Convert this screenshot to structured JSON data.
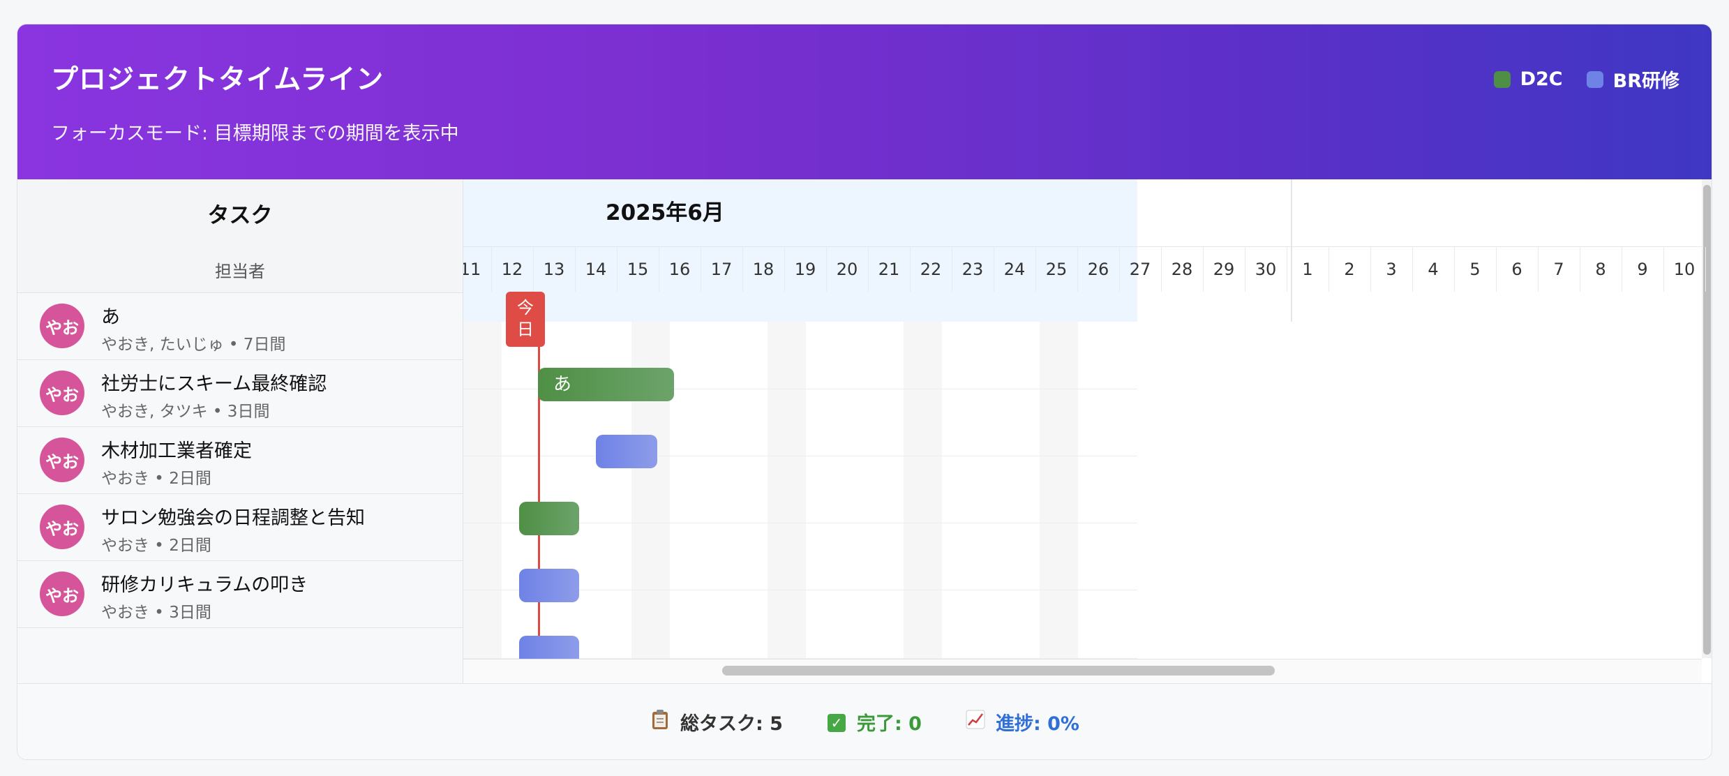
{
  "header": {
    "title": "プロジェクトタイムライン",
    "subtitle": "フォーカスモード: 目標期限までの期間を表示中",
    "legend": [
      {
        "label": "D2C",
        "color": "#4f8f45"
      },
      {
        "label": "BR研修",
        "color": "#6f82e6"
      }
    ]
  },
  "columns": {
    "task_header": "タスク",
    "assignee_header": "担当者"
  },
  "tasks": [
    {
      "avatar": "やお",
      "name": "あ",
      "meta": "やおき, たいじゅ • 7日間"
    },
    {
      "avatar": "やお",
      "name": "社労士にスキーム最終確認",
      "meta": "やおき, タツキ • 3日間"
    },
    {
      "avatar": "やお",
      "name": "木材加工業者確定",
      "meta": "やおき • 2日間"
    },
    {
      "avatar": "やお",
      "name": "サロン勉強会の日程調整と告知",
      "meta": "やおき • 2日間"
    },
    {
      "avatar": "やお",
      "name": "研修カリキュラムの叩き",
      "meta": "やおき • 3日間"
    }
  ],
  "timeline": {
    "month_label": "2025年6月",
    "days": [
      "11",
      "12",
      "13",
      "14",
      "15",
      "16",
      "17",
      "18",
      "19",
      "20",
      "21",
      "22",
      "23",
      "24",
      "25",
      "26",
      "27",
      "28",
      "29",
      "30",
      "1",
      "2",
      "3",
      "4",
      "5",
      "6",
      "7",
      "8",
      "9",
      "10"
    ],
    "today_label": "今\n日",
    "bars": [
      {
        "row": 0,
        "group": "D2C",
        "label": "あ"
      },
      {
        "row": 1,
        "group": "BR研修",
        "label": ""
      },
      {
        "row": 2,
        "group": "D2C",
        "label": ""
      },
      {
        "row": 3,
        "group": "BR研修",
        "label": ""
      },
      {
        "row": 4,
        "group": "BR研修",
        "label": ""
      }
    ]
  },
  "footer": {
    "total_label": "総タスク: 5",
    "done_label": "完了: 0",
    "progress_label": "進捗: 0%",
    "total_color": "#333333",
    "done_color": "#3a9a3a",
    "progress_color": "#2f6fd6"
  }
}
